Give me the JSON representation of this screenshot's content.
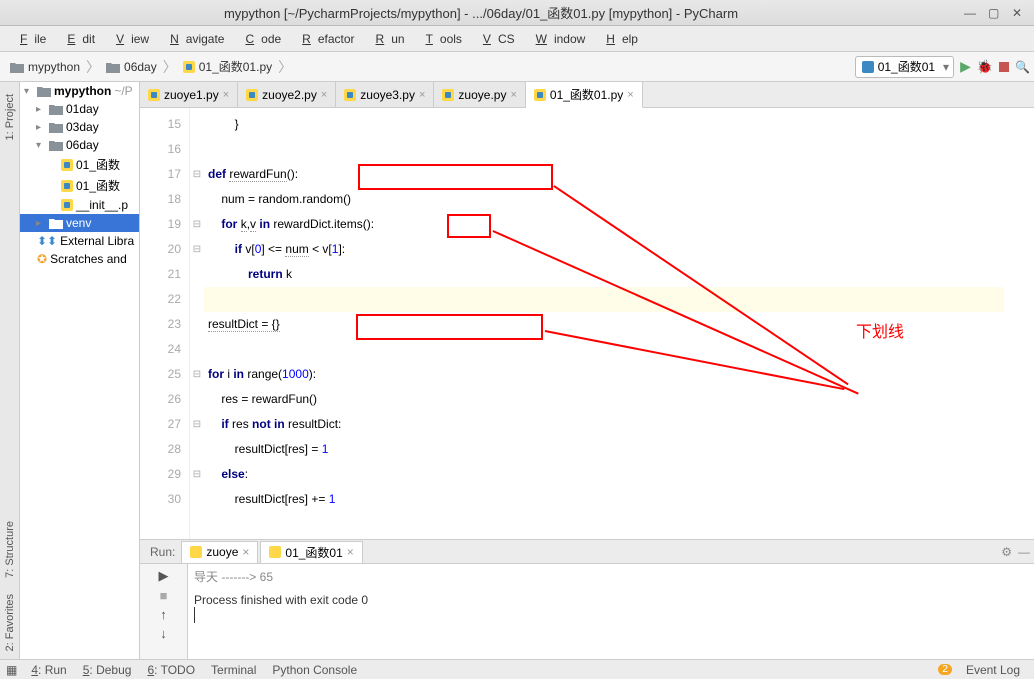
{
  "window": {
    "title": "mypython [~/PycharmProjects/mypython] - .../06day/01_函数01.py [mypython] - PyCharm"
  },
  "menu": [
    "File",
    "Edit",
    "View",
    "Navigate",
    "Code",
    "Refactor",
    "Run",
    "Tools",
    "VCS",
    "Window",
    "Help"
  ],
  "breadcrumbs": [
    {
      "icon": "folder",
      "label": "mypython"
    },
    {
      "icon": "folder",
      "label": "06day"
    },
    {
      "icon": "py",
      "label": "01_函数01.py"
    }
  ],
  "run_config": "01_函数01",
  "sidebar_tabs": {
    "project": "1: Project",
    "structure": "7: Structure",
    "favorites": "2: Favorites"
  },
  "project": {
    "root": "mypython",
    "root_suffix": "~/P",
    "items": [
      {
        "indent": 1,
        "icon": "folder",
        "label": "01day",
        "arrow": "▸"
      },
      {
        "indent": 1,
        "icon": "folder",
        "label": "03day",
        "arrow": "▸"
      },
      {
        "indent": 1,
        "icon": "folder",
        "label": "06day",
        "arrow": "▾"
      },
      {
        "indent": 2,
        "icon": "py",
        "label": "01_函数"
      },
      {
        "indent": 2,
        "icon": "py",
        "label": "01_函数"
      },
      {
        "indent": 2,
        "icon": "py",
        "label": "__init__.p"
      },
      {
        "indent": 1,
        "icon": "venv",
        "label": "venv",
        "arrow": "▸",
        "sel": true
      },
      {
        "indent": 0,
        "icon": "lib",
        "label": "External Libra"
      },
      {
        "indent": 0,
        "icon": "scratch",
        "label": "Scratches and"
      }
    ]
  },
  "tabs": [
    {
      "label": "zuoye1.py",
      "active": false
    },
    {
      "label": "zuoye2.py",
      "active": false
    },
    {
      "label": "zuoye3.py",
      "active": false
    },
    {
      "label": "zuoye.py",
      "active": false
    },
    {
      "label": "01_函数01.py",
      "active": true
    }
  ],
  "code": {
    "line_start": 15,
    "lines": [
      {
        "n": 15,
        "t": "        }"
      },
      {
        "n": 16,
        "t": ""
      },
      {
        "n": 17,
        "t": "",
        "html": "<span class='kw'>def</span> <span class='wavy'>rewardFun</span>():"
      },
      {
        "n": 18,
        "t": "",
        "html": "    num = random.random()"
      },
      {
        "n": 19,
        "t": "",
        "html": "    <span class='kw'>for</span> <span class='wavy'>k</span>,<span class='wavy'>v</span> <span class='kw'>in</span> rewardDict.items():"
      },
      {
        "n": 20,
        "t": "",
        "html": "        <span class='kw'>if</span> v[<span class='num'>0</span>] &lt;= <span class='wavy'>num</span> &lt; v[<span class='num'>1</span>]:"
      },
      {
        "n": 21,
        "t": "",
        "html": "            <span class='kw'>return</span> k"
      },
      {
        "n": 22,
        "t": "",
        "hl": true
      },
      {
        "n": 23,
        "t": "",
        "html": "<span class='wavy'>resultDict = {}</span>"
      },
      {
        "n": 24,
        "t": ""
      },
      {
        "n": 25,
        "t": "",
        "html": "<span class='kw'>for</span> i <span class='kw'>in</span> range(<span class='num'>1000</span>):"
      },
      {
        "n": 26,
        "t": "",
        "html": "    res = rewardFun()"
      },
      {
        "n": 27,
        "t": "",
        "html": "    <span class='kw'>if</span> res <span class='kw'>not in</span> resultDict:"
      },
      {
        "n": 28,
        "t": "",
        "html": "        resultDict[res] = <span class='num'>1</span>"
      },
      {
        "n": 29,
        "t": "",
        "html": "    <span class='kw'>else</span>:"
      },
      {
        "n": 30,
        "t": "",
        "html": "        resultDict[res] += <span class='num'>1</span>"
      }
    ]
  },
  "run": {
    "label": "Run:",
    "tabs": [
      "zuoye",
      "01_函数01"
    ],
    "out_line1": "导天 -------> 65",
    "out_line2": "Process finished with exit code 0"
  },
  "status": {
    "items": [
      "4: Run",
      "5: Debug",
      "6: TODO",
      "Terminal",
      "Python Console"
    ],
    "right": "Event Log",
    "badge": "2"
  },
  "annotation": {
    "label": "下划线"
  }
}
